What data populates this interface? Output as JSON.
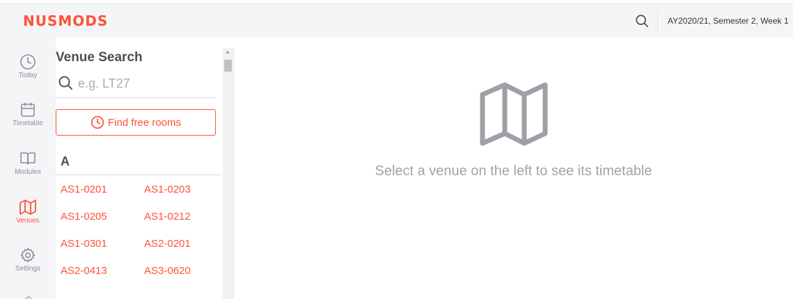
{
  "header": {
    "logo": "NUSMODS",
    "search_icon": "search-icon",
    "semester": "AY2020/21, Semester 2, Week 1",
    "bg_color": "#f4f5f7",
    "accent_color": "#ff5138"
  },
  "nav": {
    "items": [
      {
        "label": "Today",
        "icon": "clock-icon",
        "active": false
      },
      {
        "label": "Timetable",
        "icon": "calendar-icon",
        "active": false
      },
      {
        "label": "Modules",
        "icon": "book-icon",
        "active": false
      },
      {
        "label": "Venues",
        "icon": "map-icon",
        "active": true
      },
      {
        "label": "Settings",
        "icon": "gear-icon",
        "active": false
      }
    ]
  },
  "venue_panel": {
    "title": "Venue Search",
    "search_placeholder": "e.g. LT27",
    "search_value": "",
    "find_button": "Find free rooms",
    "section": "A",
    "venues": [
      "AS1-0201",
      "AS1-0203",
      "AS1-0205",
      "AS1-0212",
      "AS1-0301",
      "AS2-0201",
      "AS2-0413",
      "AS3-0620"
    ]
  },
  "main": {
    "empty_icon": "map-icon",
    "empty_message": "Select a venue on the left to see its timetable"
  }
}
